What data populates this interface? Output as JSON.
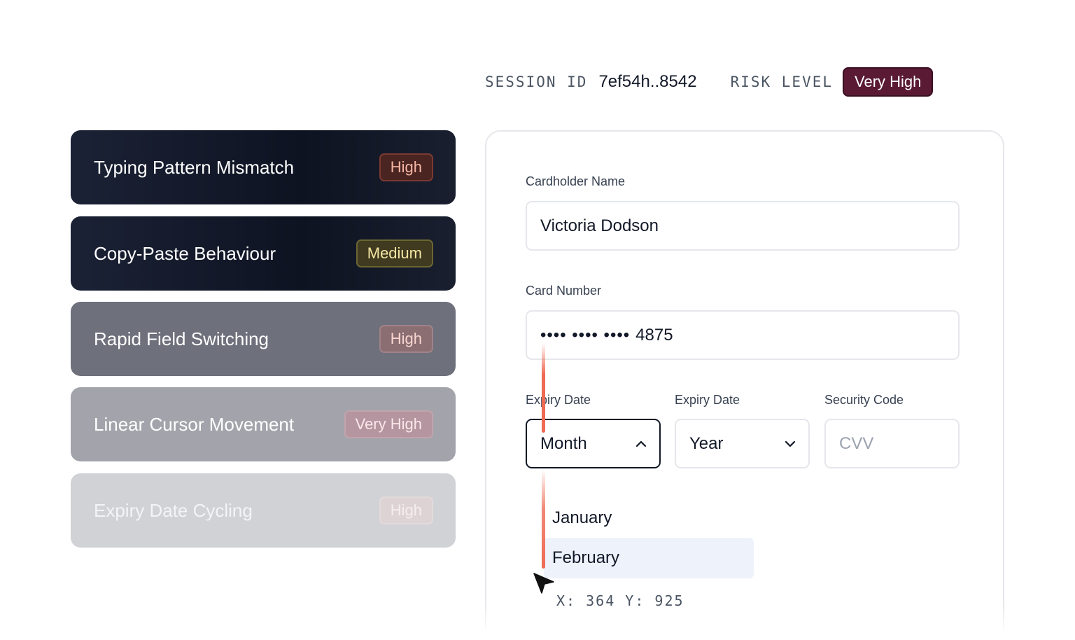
{
  "session": {
    "id_label": "SESSION ID",
    "id_value": "7ef54h..8542",
    "risk_label": "RISK LEVEL",
    "risk_value": "Very High"
  },
  "signals": [
    {
      "label": "Typing Pattern Mismatch",
      "severity": "High"
    },
    {
      "label": "Copy-Paste Behaviour",
      "severity": "Medium"
    },
    {
      "label": "Rapid Field Switching",
      "severity": "High"
    },
    {
      "label": "Linear Cursor Movement",
      "severity": "Very High"
    },
    {
      "label": "Expiry Date Cycling",
      "severity": "High"
    }
  ],
  "form": {
    "cardholder_label": "Cardholder Name",
    "cardholder_value": "Victoria Dodson",
    "card_number_label": "Card Number",
    "card_number_mask": "•••• •••• ••••",
    "card_number_last4": "4875",
    "expiry_month_label": "Expiry Date",
    "expiry_month_value": "Month",
    "expiry_year_label": "Expiry Date",
    "expiry_year_value": "Year",
    "cvv_label": "Security Code",
    "cvv_placeholder": "CVV"
  },
  "month_dropdown": {
    "options": [
      "January",
      "February"
    ],
    "highlighted": "February"
  },
  "cursor_readout": "X: 364 Y: 925",
  "colors": {
    "risk_very_high": "#5a1a33",
    "trail": "#ef6a54",
    "option_hover": "#eef3fb"
  },
  "icons": {
    "month_select": "chevron-up-icon",
    "year_select": "chevron-down-icon",
    "cursor": "mouse-pointer-icon"
  }
}
